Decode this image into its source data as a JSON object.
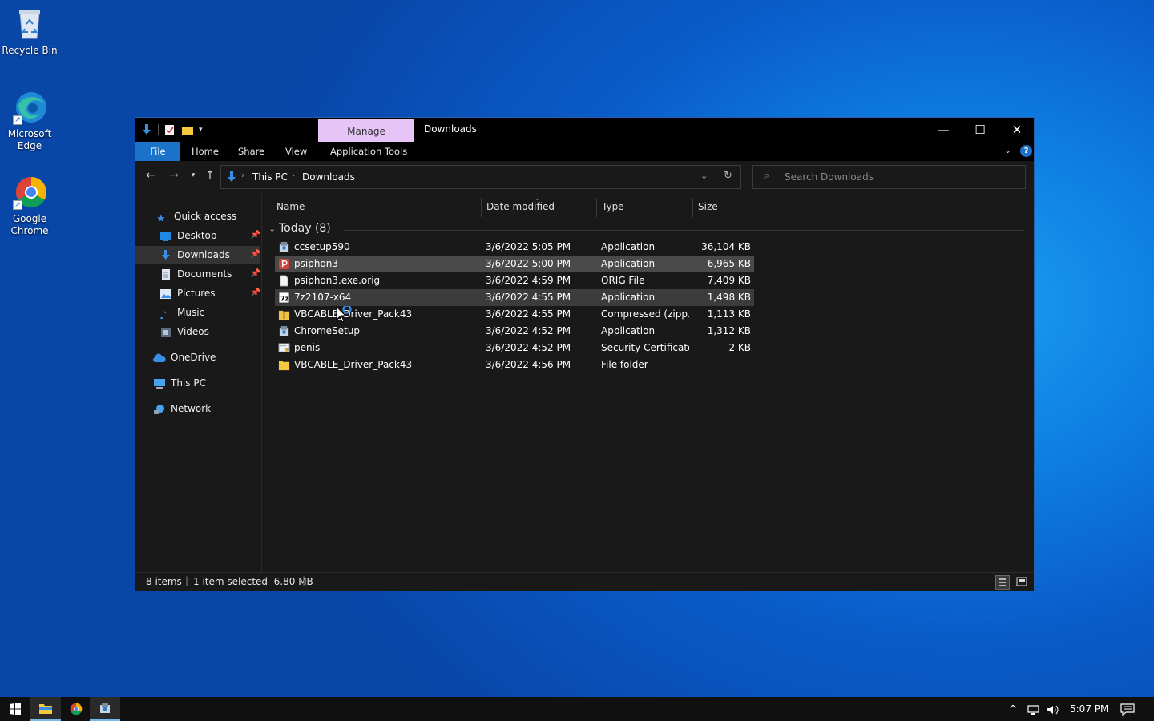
{
  "desktop": {
    "icons": [
      {
        "label": "Recycle Bin",
        "icon": "recycle-bin-icon"
      },
      {
        "label": "Microsoft Edge",
        "icon": "edge-icon"
      },
      {
        "label": "Google Chrome",
        "icon": "chrome-icon"
      }
    ]
  },
  "window": {
    "title": "Downloads",
    "contextual_tab": "Manage",
    "ribbon_tabs": [
      "File",
      "Home",
      "Share",
      "View",
      "Application Tools"
    ],
    "controls": {
      "minimize": "—",
      "maximize": "☐",
      "close": "✕"
    },
    "help": "?"
  },
  "address": {
    "crumbs": [
      "This PC",
      "Downloads"
    ],
    "search_placeholder": "Search Downloads"
  },
  "nav": {
    "quick_access": "Quick access",
    "pinned": [
      {
        "label": "Desktop",
        "pinned": true
      },
      {
        "label": "Downloads",
        "pinned": true
      },
      {
        "label": "Documents",
        "pinned": true
      },
      {
        "label": "Pictures",
        "pinned": true
      },
      {
        "label": "Music",
        "pinned": false
      },
      {
        "label": "Videos",
        "pinned": false
      }
    ],
    "onedrive": "OneDrive",
    "this_pc": "This PC",
    "network": "Network"
  },
  "columns": {
    "name": "Name",
    "date": "Date modified",
    "type": "Type",
    "size": "Size"
  },
  "group": "Today (8)",
  "files": [
    {
      "name": "ccsetup590",
      "date": "3/6/2022 5:05 PM",
      "type": "Application",
      "size": "36,104 KB",
      "icon": "installer-icon"
    },
    {
      "name": "psiphon3",
      "date": "3/6/2022 5:00 PM",
      "type": "Application",
      "size": "6,965 KB",
      "icon": "psiphon-icon"
    },
    {
      "name": "psiphon3.exe.orig",
      "date": "3/6/2022 4:59 PM",
      "type": "ORIG File",
      "size": "7,409 KB",
      "icon": "blank-file-icon"
    },
    {
      "name": "7z2107-x64",
      "date": "3/6/2022 4:55 PM",
      "type": "Application",
      "size": "1,498 KB",
      "icon": "7zip-icon"
    },
    {
      "name": "VBCABLE_Driver_Pack43",
      "date": "3/6/2022 4:55 PM",
      "type": "Compressed (zipp...",
      "size": "1,113 KB",
      "icon": "zip-folder-icon"
    },
    {
      "name": "ChromeSetup",
      "date": "3/6/2022 4:52 PM",
      "type": "Application",
      "size": "1,312 KB",
      "icon": "installer-icon"
    },
    {
      "name": "penis",
      "date": "3/6/2022 4:52 PM",
      "type": "Security Certificate",
      "size": "2 KB",
      "icon": "certificate-icon"
    },
    {
      "name": "VBCABLE_Driver_Pack43",
      "date": "3/6/2022 4:56 PM",
      "type": "File folder",
      "size": "",
      "icon": "folder-icon"
    }
  ],
  "status": {
    "count": "8 items",
    "selection": "1 item selected  6.80 MB"
  },
  "taskbar": {
    "time": "5:07 PM"
  },
  "colors": {
    "accent": "#1a73c8",
    "manage": "#e6c5f6",
    "selected_row": "#4a4a4a"
  }
}
